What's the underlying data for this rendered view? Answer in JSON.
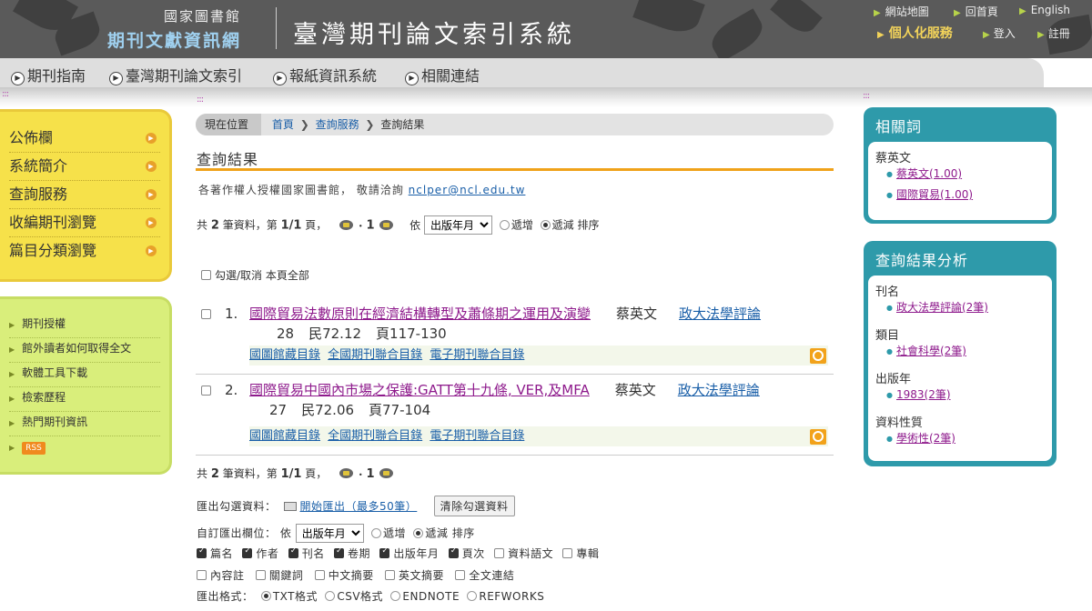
{
  "header": {
    "org_name": "國家圖書館",
    "logo_text": "期刊文獻資訊網",
    "site_title": "臺灣期刊論文索引系統",
    "links": [
      "網站地圖",
      "回首頁",
      "English"
    ],
    "personal": "個人化服務",
    "login": "登入",
    "register": "註冊"
  },
  "nav": {
    "items": [
      "期刊指南",
      "臺灣期刊論文索引",
      "報紙資訊系統",
      "相關連結"
    ]
  },
  "left_menu": {
    "primary": [
      "公佈欄",
      "系統簡介",
      "查詢服務",
      "收編期刊瀏覽",
      "篇目分類瀏覽"
    ],
    "secondary": [
      "期刊授權",
      "館外讀者如何取得全文",
      "軟體工具下載",
      "檢索歷程",
      "熱門期刊資訊"
    ],
    "rss_label": "RSS"
  },
  "breadcrumb": {
    "here": "現在位置",
    "items": [
      "首頁",
      "查詢服務",
      "查詢結果"
    ]
  },
  "main": {
    "title": "查詢結果",
    "copyright_text": "各著作權人授權國家圖書館， 敬請洽詢",
    "copyright_email": "nclper@ncl.edu.tw",
    "pager": {
      "prefix": "共",
      "total": "2",
      "unit": "筆資料，第",
      "page": "1/1",
      "page_suffix": "頁，",
      "current": "1",
      "sort_by": "依",
      "sort_field": "出版年月",
      "asc_label": "遞增",
      "desc_label": "遞減",
      "sort_label": "排序"
    },
    "select_all": "勾選/取消 本頁全部",
    "records": [
      {
        "num": "1.",
        "title": "國際貿易法數原則在經濟結構轉型及蕭條期之運用及演變",
        "author": "蔡英文",
        "journal": "政大法學評論",
        "volume": "28",
        "date": "民72.12",
        "pages": "頁117-130",
        "links": [
          "國圖館藏目錄",
          "全國期刊聯合目錄",
          "電子期刊聯合目錄"
        ]
      },
      {
        "num": "2.",
        "title": "國際貿易中國內市場之保護:GATT第十九條, VER,及MFA",
        "author": "蔡英文",
        "journal": "政大法學評論",
        "volume": "27",
        "date": "民72.06",
        "pages": "頁77-104",
        "links": [
          "國圖館藏目錄",
          "全國期刊聯合目錄",
          "電子期刊聯合目錄"
        ]
      }
    ],
    "export": {
      "label": "匯出勾選資料：",
      "start": "開始匯出（最多50筆）",
      "clear": "清除勾選資料",
      "custom_label": "自訂匯出欄位：",
      "sort_by": "依",
      "sort_field": "出版年月",
      "asc_label": "遞增",
      "desc_label": "遞減",
      "sort_label": "排序",
      "fields_row1": [
        {
          "label": "篇名",
          "checked": true
        },
        {
          "label": "作者",
          "checked": true
        },
        {
          "label": "刊名",
          "checked": true
        },
        {
          "label": "卷期",
          "checked": true
        },
        {
          "label": "出版年月",
          "checked": true
        },
        {
          "label": "頁次",
          "checked": true
        },
        {
          "label": "資料語文",
          "checked": false
        },
        {
          "label": "專輯",
          "checked": false
        }
      ],
      "fields_row2": [
        {
          "label": "內容註",
          "checked": false
        },
        {
          "label": "關鍵詞",
          "checked": false
        },
        {
          "label": "中文摘要",
          "checked": false
        },
        {
          "label": "英文摘要",
          "checked": false
        },
        {
          "label": "全文連結",
          "checked": false
        }
      ],
      "format_label": "匯出格式：",
      "formats": [
        {
          "label": "TXT格式",
          "selected": true
        },
        {
          "label": "CSV格式",
          "selected": false
        },
        {
          "label": "ENDNOTE",
          "selected": false
        },
        {
          "label": "REFWORKS",
          "selected": false
        }
      ]
    }
  },
  "right": {
    "related_title": "相關詞",
    "related_head": "蔡英文",
    "related_items": [
      "蔡英文(1.00)",
      "國際貿易(1.00)"
    ],
    "analysis_title": "查詢結果分析",
    "analysis": [
      {
        "head": "刊名",
        "item": "政大法學評論(2筆)"
      },
      {
        "head": "類目",
        "item": "社會科學(2筆)"
      },
      {
        "head": "出版年",
        "item": "1983(2筆)"
      },
      {
        "head": "資料性質",
        "item": "學術性(2筆)"
      }
    ]
  },
  "colors": {
    "header_bg": "#5a5a5a",
    "nav_bg": "#dedede",
    "yellow_menu": "#f6e14a",
    "green_menu": "#d9ee7b",
    "panel_teal": "#2e9aaa",
    "title_underline": "#f0a21a",
    "record_title": "#8e1a8c",
    "link": "#1a5fa8"
  }
}
